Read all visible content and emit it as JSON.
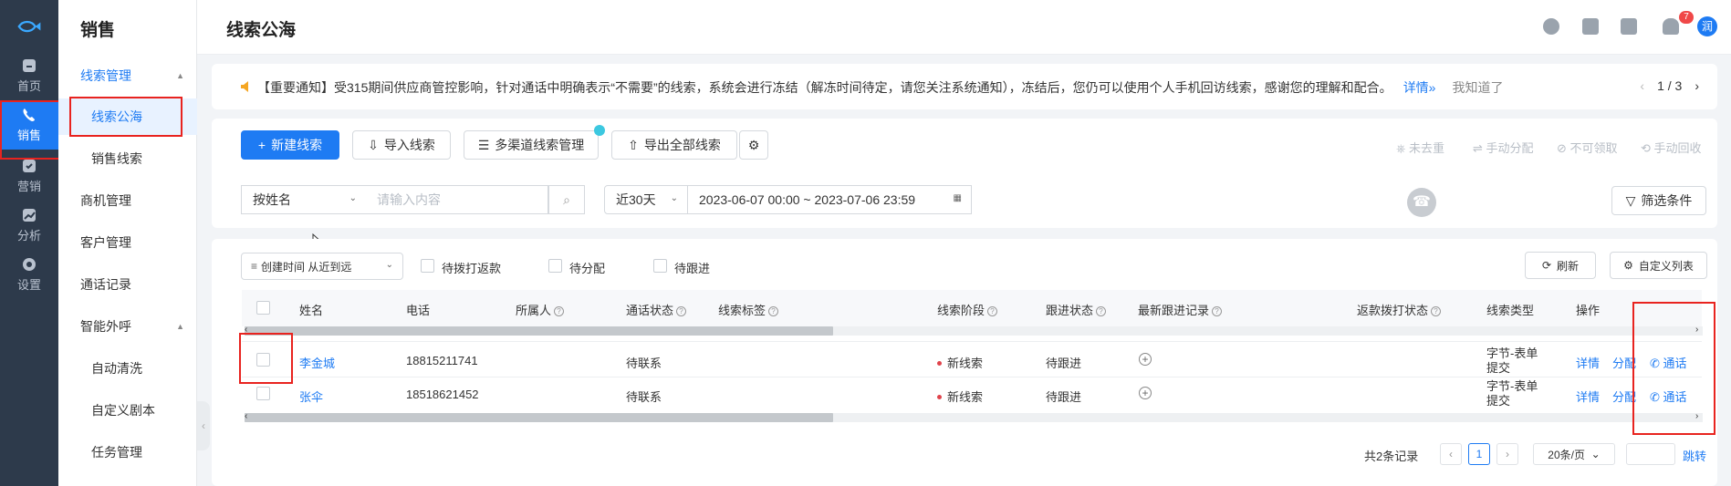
{
  "rail": {
    "items": [
      {
        "label": "",
        "icon": "fish-logo-icon"
      },
      {
        "label": "首页",
        "icon": "home-icon"
      },
      {
        "label": "销售",
        "icon": "phone-icon"
      },
      {
        "label": "营销",
        "icon": "marketing-icon"
      },
      {
        "label": "分析",
        "icon": "chart-icon"
      },
      {
        "label": "设置",
        "icon": "gear-icon"
      }
    ]
  },
  "sidebar": {
    "title": "销售",
    "items": [
      {
        "label": "线索管理"
      },
      {
        "label": "线索公海"
      },
      {
        "label": "销售线索"
      },
      {
        "label": "商机管理"
      },
      {
        "label": "客户管理"
      },
      {
        "label": "通话记录"
      },
      {
        "label": "智能外呼"
      },
      {
        "label": "自动清洗"
      },
      {
        "label": "自定义剧本"
      },
      {
        "label": "任务管理"
      }
    ]
  },
  "header": {
    "title": "线索公海",
    "notification_count": "7",
    "avatar_text": "润"
  },
  "notice": {
    "text": "【重要通知】受315期间供应商管控影响，针对通话中明确表示“不需要”的线索，系统会进行冻结（解冻时间待定，请您关注系统通知），冻结后，您仍可以使用个人手机回访线索，感谢您的理解和配合。",
    "detail_link": "详情»",
    "dismiss": "我知道了",
    "pager": "1 / 3"
  },
  "toolbar": {
    "new_lead": "新建线索",
    "import": "导入线索",
    "multichannel": "多渠道线索管理",
    "export": "导出全部线索",
    "actions": [
      "未去重",
      "手动分配",
      "不可领取",
      "手动回收"
    ]
  },
  "filter": {
    "search_type": "按姓名",
    "search_placeholder": "请输入内容",
    "range": "近30天",
    "date_range": "2023-06-07 00:00 ~ 2023-07-06 23:59",
    "filter_button": "筛选条件"
  },
  "table_tools": {
    "sort": "创建时间 从近到远",
    "checks": [
      "待拨打返款",
      "待分配",
      "待跟进"
    ],
    "refresh": "刷新",
    "custom_columns": "自定义列表"
  },
  "table": {
    "columns": [
      "姓名",
      "电话",
      "所属人",
      "通话状态",
      "线索标签",
      "线索阶段",
      "跟进状态",
      "最新跟进记录",
      "返款拨打状态",
      "线索类型",
      "操作"
    ],
    "rows": [
      {
        "name": "李金城",
        "phone": "18815211741",
        "call_status": "待联系",
        "stage": "新线索",
        "follow": "待跟进",
        "type": "字节-表单提交"
      },
      {
        "name": "张伞",
        "phone": "18518621452",
        "call_status": "待联系",
        "stage": "新线索",
        "follow": "待跟进",
        "type": "字节-表单提交"
      }
    ],
    "row_actions": [
      "详情",
      "分配",
      "通话"
    ]
  },
  "pagination": {
    "total": "共2条记录",
    "page": "1",
    "page_size": "20条/页",
    "jump": "跳转"
  },
  "colors": {
    "accent": "#1e7bf3",
    "rail": "#2d3a4b",
    "highlight": "#e8231f"
  }
}
